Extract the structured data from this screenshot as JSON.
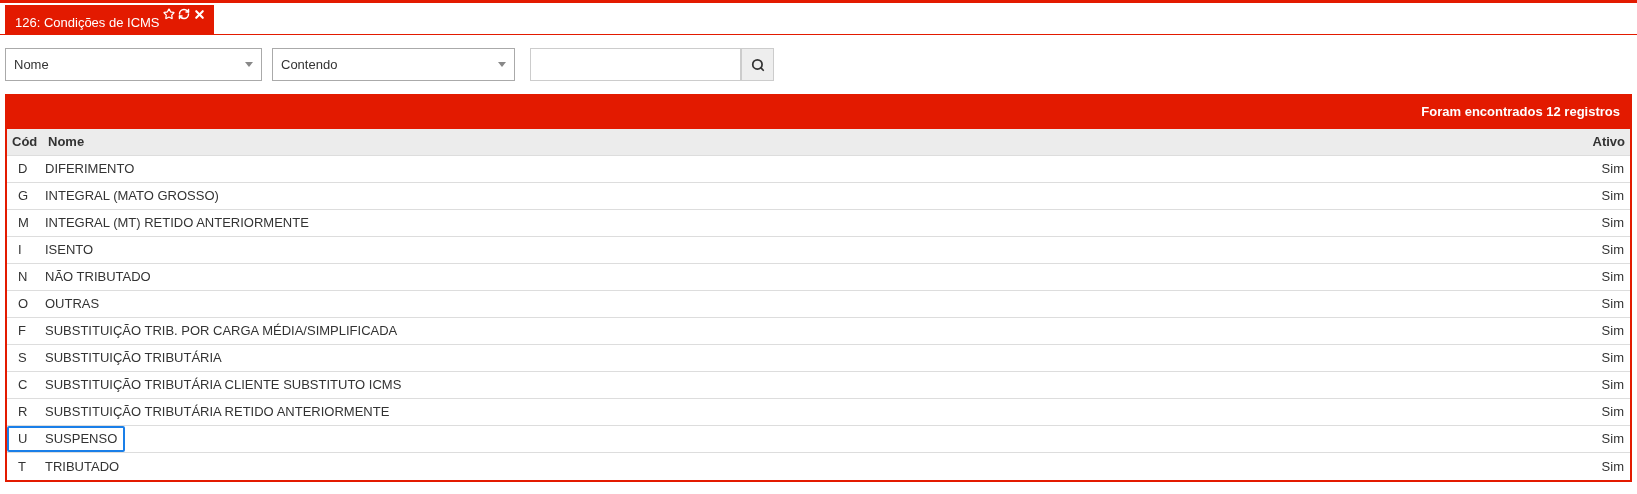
{
  "tab": {
    "label": "126: Condições de ICMS",
    "selected": true
  },
  "filters": {
    "field": "Nome",
    "operator": "Contendo"
  },
  "results": {
    "summary": "Foram encontrados 12 registros"
  },
  "table": {
    "columns": [
      "Cód",
      "Nome",
      "Ativo"
    ],
    "rows": [
      {
        "code": "D",
        "name": "DIFERIMENTO",
        "active": "Sim",
        "highlighted": false
      },
      {
        "code": "G",
        "name": "INTEGRAL (MATO GROSSO)",
        "active": "Sim",
        "highlighted": false
      },
      {
        "code": "M",
        "name": "INTEGRAL (MT) RETIDO ANTERIORMENTE",
        "active": "Sim",
        "highlighted": false
      },
      {
        "code": "I",
        "name": "ISENTO",
        "active": "Sim",
        "highlighted": false
      },
      {
        "code": "N",
        "name": "NÃO TRIBUTADO",
        "active": "Sim",
        "highlighted": false
      },
      {
        "code": "O",
        "name": "OUTRAS",
        "active": "Sim",
        "highlighted": false
      },
      {
        "code": "F",
        "name": "SUBSTITUIÇÃO TRIB. POR CARGA MÉDIA/SIMPLIFICADA",
        "active": "Sim",
        "highlighted": false
      },
      {
        "code": "S",
        "name": "SUBSTITUIÇÃO TRIBUTÁRIA",
        "active": "Sim",
        "highlighted": false
      },
      {
        "code": "C",
        "name": "SUBSTITUIÇÃO TRIBUTÁRIA CLIENTE SUBSTITUTO ICMS",
        "active": "Sim",
        "highlighted": false
      },
      {
        "code": "R",
        "name": "SUBSTITUIÇÃO TRIBUTÁRIA RETIDO ANTERIORMENTE",
        "active": "Sim",
        "highlighted": false
      },
      {
        "code": "U",
        "name": "SUSPENSO",
        "active": "Sim",
        "highlighted": true
      },
      {
        "code": "T",
        "name": "TRIBUTADO",
        "active": "Sim",
        "highlighted": false
      }
    ]
  }
}
